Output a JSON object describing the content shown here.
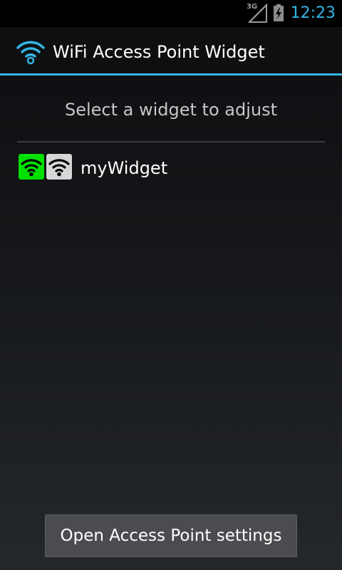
{
  "status_bar": {
    "network_label": "3G",
    "time": "12:23",
    "icons": [
      "signal-3g-icon",
      "battery-charging-icon"
    ]
  },
  "action_bar": {
    "title": "WiFi Access Point Widget",
    "icon": "wifi-icon"
  },
  "main": {
    "prompt": "Select a widget to adjust",
    "widgets": [
      {
        "name": "myWidget",
        "icons": [
          "wifi-on-icon",
          "wifi-off-icon"
        ]
      }
    ]
  },
  "footer": {
    "button_label": "Open Access Point settings"
  },
  "colors": {
    "accent": "#33b5e5",
    "widget_on": "#00e000",
    "widget_off": "#d6d6d6"
  }
}
